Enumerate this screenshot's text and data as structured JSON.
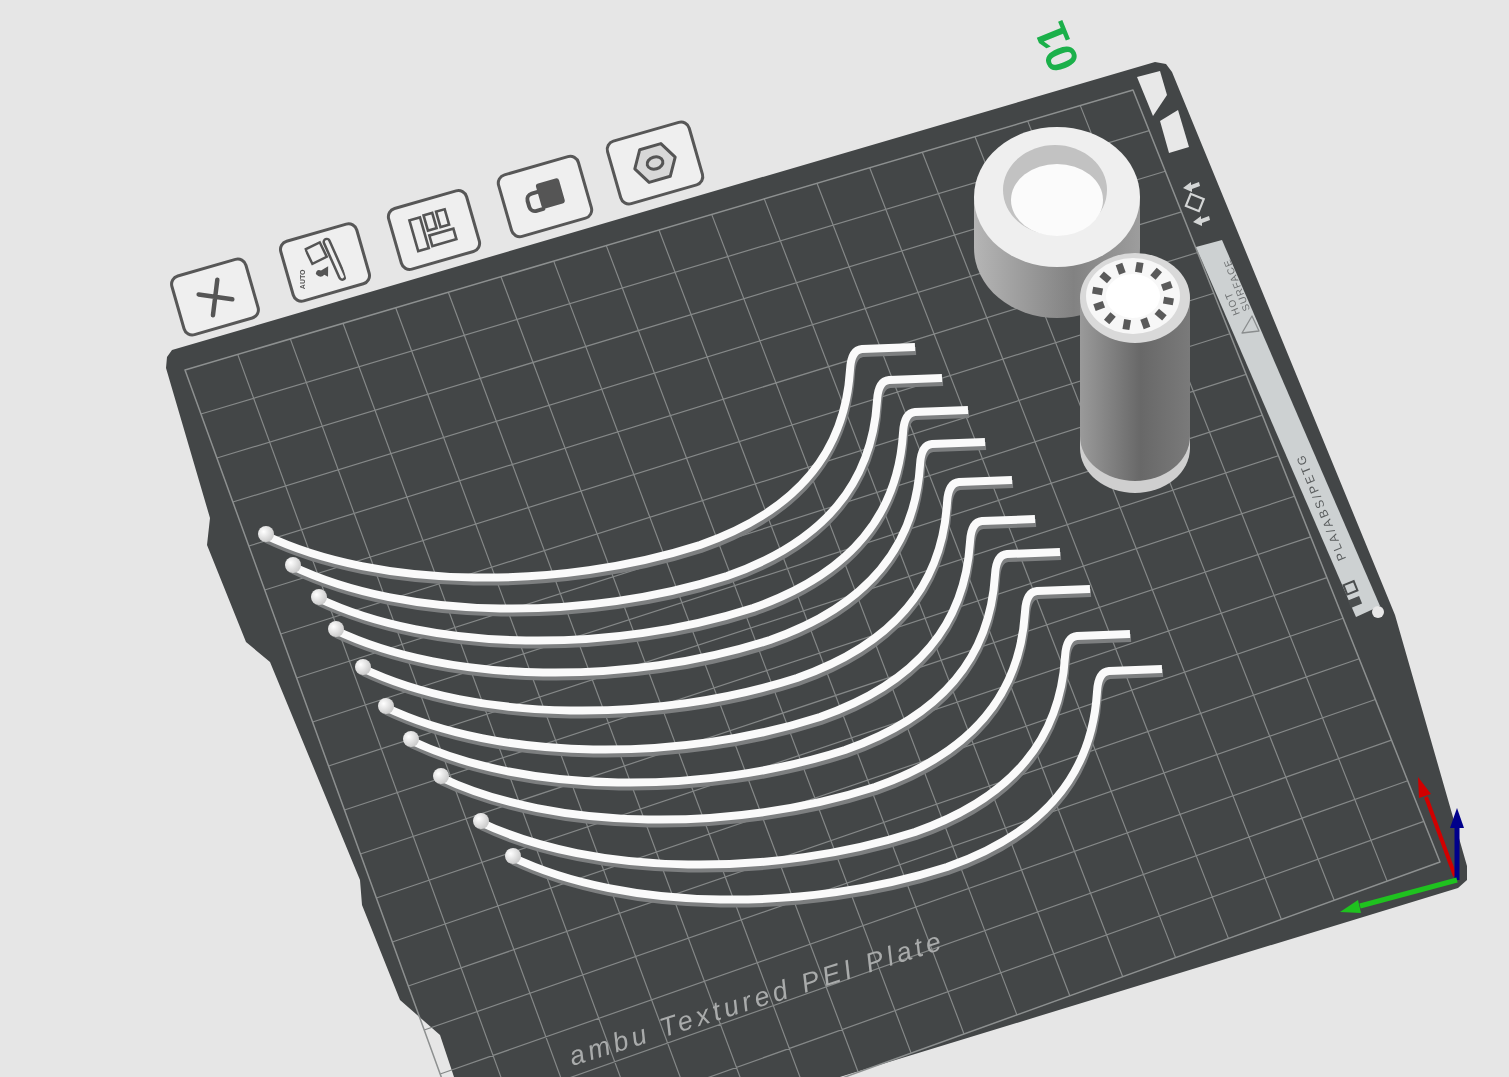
{
  "plate_number": "01",
  "plate_toolbar": [
    {
      "kind": "delete"
    },
    {
      "kind": "auto_orient",
      "label": "AUTO"
    },
    {
      "kind": "arrange"
    },
    {
      "kind": "lock"
    },
    {
      "kind": "settings"
    }
  ],
  "build_plate": {
    "name": "ambu Textured PEI Plate",
    "warning": "HOT SURFACE",
    "materials": "PLA/ABS/PETG"
  }
}
